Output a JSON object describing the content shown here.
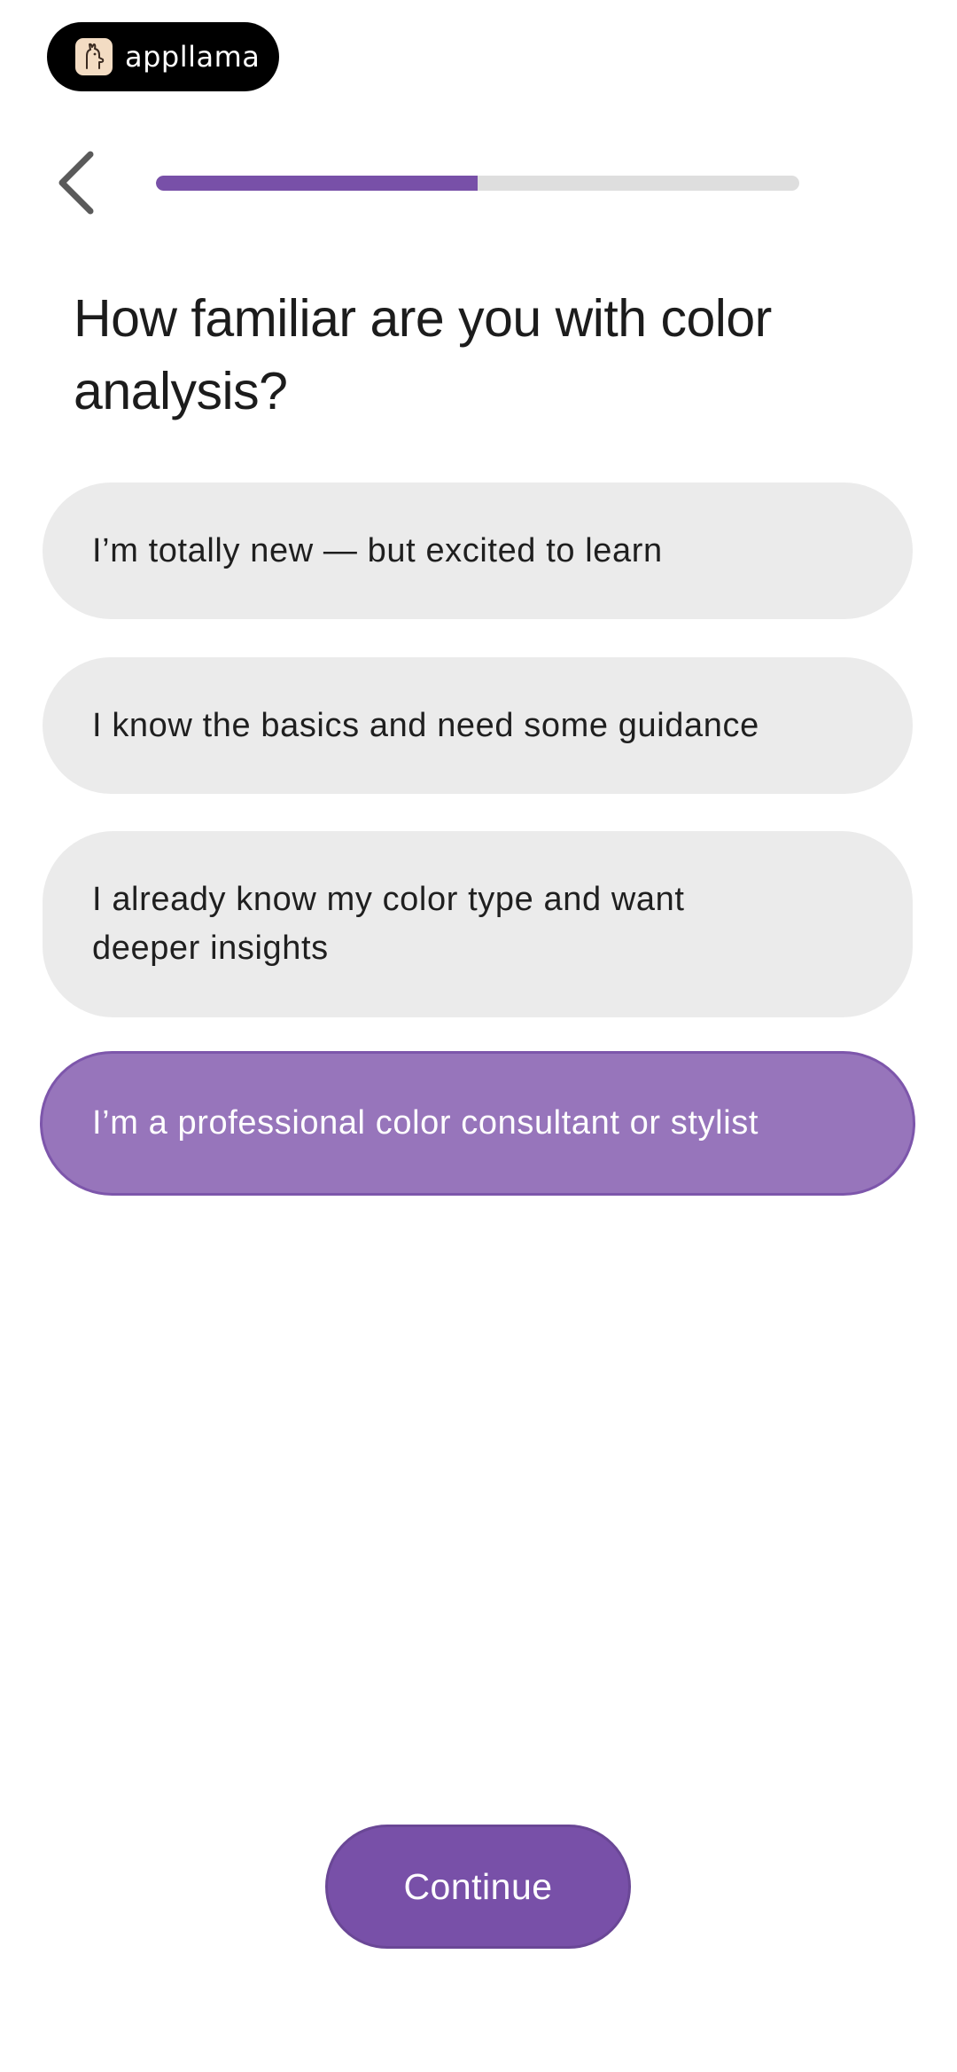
{
  "brand": {
    "name": "appllama",
    "icon": "llama-logo-icon"
  },
  "nav": {
    "back_icon": "chevron-left-icon",
    "progress_fraction": 0.5
  },
  "question": "How familiar are you with color analysis?",
  "options": [
    {
      "label": "I’m totally new — but excited to learn",
      "selected": false
    },
    {
      "label": "I know the basics and need some guidance",
      "selected": false
    },
    {
      "label": "I already know my color type and want deeper insights",
      "selected": false
    },
    {
      "label": "I’m a professional color consultant or stylist",
      "selected": true
    }
  ],
  "continue_label": "Continue",
  "colors": {
    "accent": "#7850a8",
    "selected_option": "#9775bb",
    "option_bg": "#ebebeb",
    "progress_track": "#dedede"
  }
}
